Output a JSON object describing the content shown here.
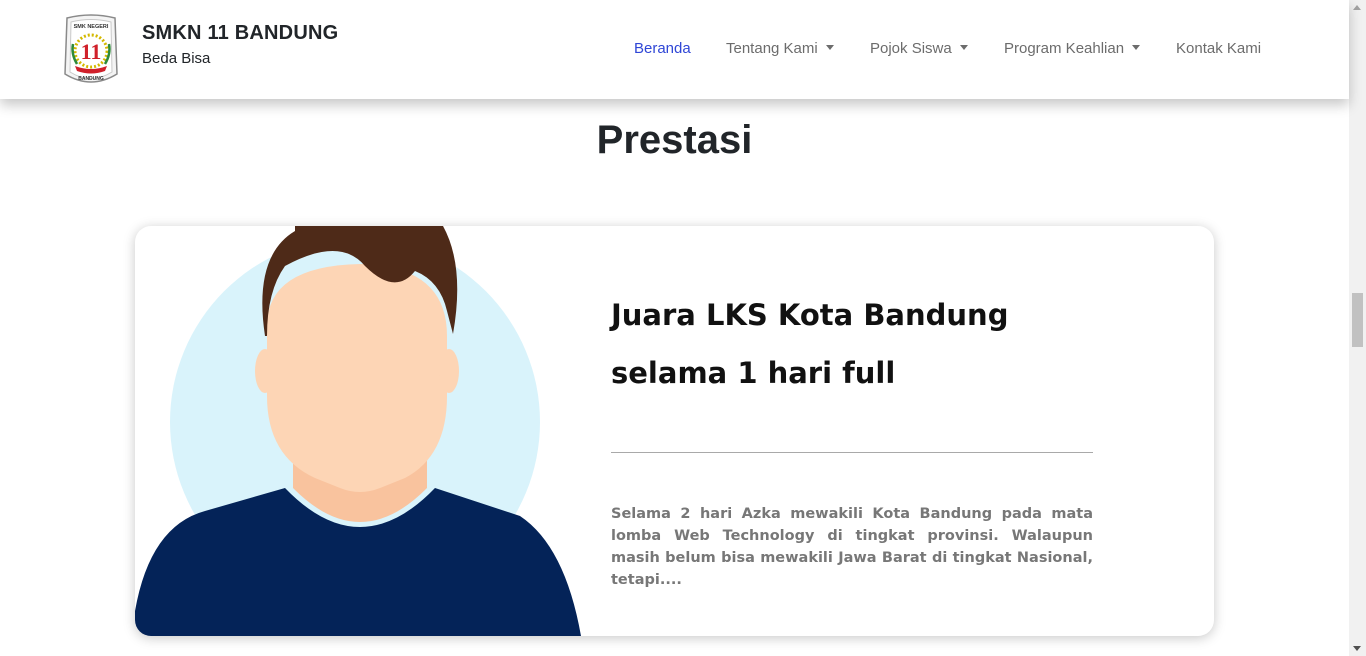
{
  "navbar": {
    "logo_alt": "SMK NEGERI 11 BANDUNG",
    "logo_top_text": "SMK NEGERI",
    "logo_number": "11",
    "logo_bottom_text": "BANDUNG",
    "brand_title": "SMKN 11 BANDUNG",
    "brand_subtitle": "Beda Bisa",
    "items": [
      {
        "label": "Beranda",
        "active": true,
        "dropdown": false
      },
      {
        "label": "Tentang Kami",
        "active": false,
        "dropdown": true
      },
      {
        "label": "Pojok Siswa",
        "active": false,
        "dropdown": true
      },
      {
        "label": "Program Keahlian",
        "active": false,
        "dropdown": true
      },
      {
        "label": "Kontak Kami",
        "active": false,
        "dropdown": false
      }
    ]
  },
  "section": {
    "title": "Prestasi"
  },
  "card": {
    "title": "Juara LKS Kota Bandung selama 1 hari full",
    "description": "Selama 2 hari Azka mewakili Kota Bandung pada mata lomba Web Technology di tingkat provinsi. Walaupun masih belum bisa mewakili Jawa Barat di tingkat Nasional, tetapi....",
    "image_icon": "person-avatar-illustration"
  },
  "colors": {
    "active_link": "#2f46d6",
    "nav_link": "#6c6c6c",
    "avatar_bg": "#d9f3fb",
    "hair": "#4e2a18",
    "skin": "#fdd5b5",
    "shirt": "#042358"
  }
}
